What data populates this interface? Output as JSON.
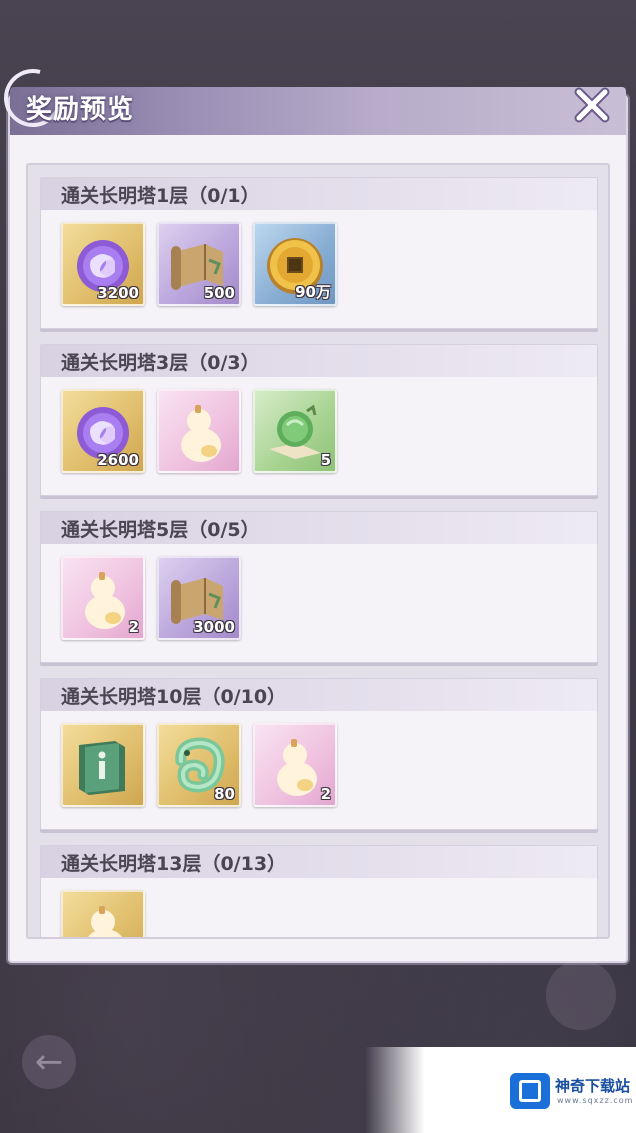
{
  "dialog": {
    "title": "奖励预览",
    "close_icon": "close-x-icon"
  },
  "rewards": [
    {
      "title": "通关长明塔1层（0/1）",
      "items": [
        {
          "icon": "purple-orb-icon",
          "rarity": "gold",
          "count": "3200"
        },
        {
          "icon": "map-scroll-icon",
          "rarity": "purple",
          "count": "500"
        },
        {
          "icon": "gold-coin-icon",
          "rarity": "blue",
          "count": "90万"
        }
      ]
    },
    {
      "title": "通关长明塔3层（0/3）",
      "items": [
        {
          "icon": "purple-orb-icon",
          "rarity": "gold",
          "count": "2600"
        },
        {
          "icon": "gourd-icon",
          "rarity": "pink",
          "count": ""
        },
        {
          "icon": "green-orb-icon",
          "rarity": "green",
          "count": "5"
        }
      ]
    },
    {
      "title": "通关长明塔5层（0/5）",
      "items": [
        {
          "icon": "gourd-icon",
          "rarity": "pink",
          "count": "2"
        },
        {
          "icon": "map-scroll-icon",
          "rarity": "purple",
          "count": "3000"
        }
      ]
    },
    {
      "title": "通关长明塔10层（0/10）",
      "items": [
        {
          "icon": "green-book-icon",
          "rarity": "gold",
          "count": ""
        },
        {
          "icon": "jade-dragon-icon",
          "rarity": "gold",
          "count": "80"
        },
        {
          "icon": "gourd-icon",
          "rarity": "pink",
          "count": "2"
        }
      ]
    },
    {
      "title": "通关长明塔13层（0/13）",
      "items": [
        {
          "icon": "gourd-icon",
          "rarity": "gold",
          "count": ""
        }
      ]
    }
  ],
  "watermark": {
    "title": "神奇下载站",
    "url": "www.sqxzz.com"
  }
}
